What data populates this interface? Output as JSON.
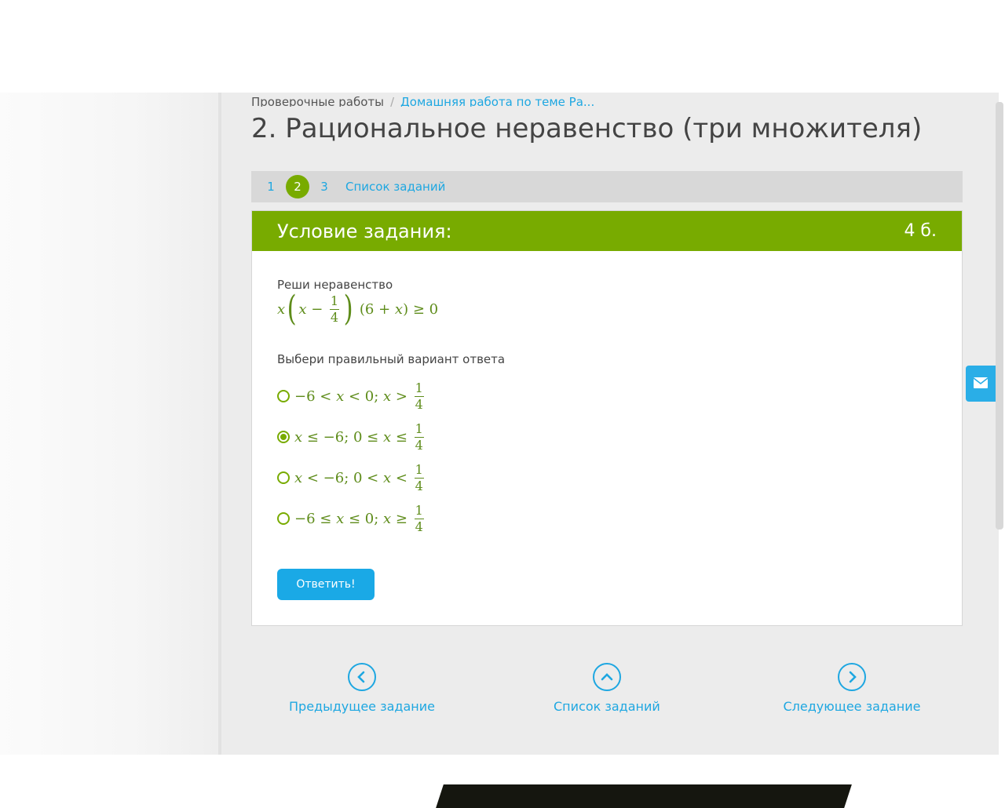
{
  "breadcrumb": {
    "root": "Проверочные работы",
    "separator": "/",
    "current": "Домашняя работа по теме Ра..."
  },
  "page_title": "2. Рациональное неравенство (три множителя)",
  "tabs": {
    "items": [
      "1",
      "2",
      "3"
    ],
    "active": "2",
    "list_label": "Список заданий"
  },
  "task": {
    "header_title": "Условие задания:",
    "points": "4 б.",
    "prompt": "Реши неравенство",
    "instruction": "Выбери правильный вариант ответа",
    "selected_option": 2,
    "submit_label": "Ответить!"
  },
  "navigation": {
    "prev": "Предыдущее задание",
    "list": "Список заданий",
    "next": "Следующее задание"
  },
  "icons": {
    "mail": "envelope-icon",
    "prev": "chevron-left-icon",
    "list": "chevron-up-icon",
    "next": "chevron-right-icon"
  },
  "colors": {
    "accent_green": "#78ab00",
    "link_blue": "#1ea7e1",
    "button_blue": "#1aa9e6"
  }
}
